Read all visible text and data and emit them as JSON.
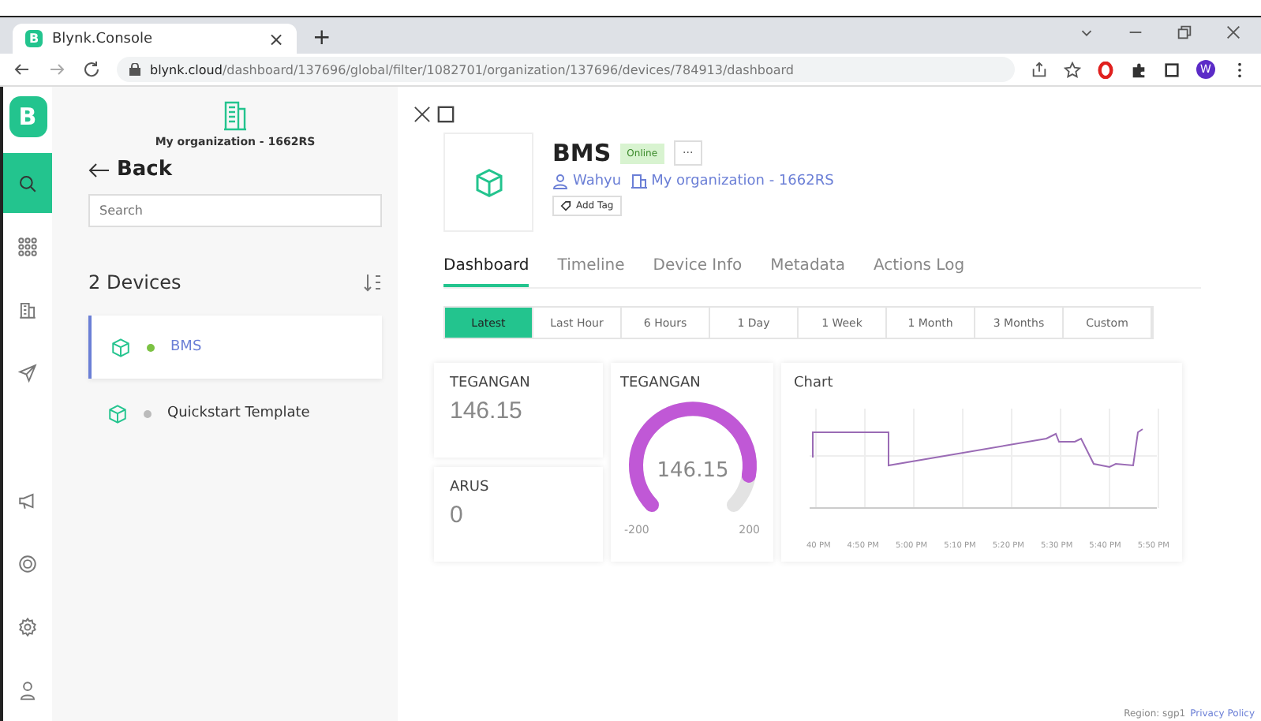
{
  "browser": {
    "favicon": "B",
    "tab_title": "Blynk.Console",
    "tab_close": "×",
    "new_tab": "+",
    "url_host": "blynk.cloud",
    "url_path": "/dashboard/137696/global/filter/1082701/organization/137696/devices/784913/dashboard",
    "profile": "W"
  },
  "rail": {
    "logo": "B",
    "items": [
      {
        "kind": "search",
        "selected": true
      },
      {
        "kind": "grid",
        "selected": false
      },
      {
        "kind": "building",
        "selected": false
      },
      {
        "kind": "send",
        "selected": false
      }
    ],
    "bottom_items": [
      {
        "kind": "megaphone",
        "selected": false
      },
      {
        "kind": "help",
        "selected": false
      },
      {
        "kind": "settings",
        "selected": false
      },
      {
        "kind": "user",
        "selected": false
      }
    ]
  },
  "sidebar": {
    "organization": "My organization - 1662RS",
    "back": "Back",
    "search": {
      "placeholder": "Search"
    },
    "count": "2 Devices",
    "devices": [
      {
        "name": "BMS",
        "online": true,
        "selected": true
      },
      {
        "name": "Quickstart Template",
        "online": false,
        "selected": false
      }
    ]
  },
  "device": {
    "name": "BMS",
    "status": "Online",
    "more": "···",
    "owner": "Wahyu",
    "organization": "My organization - 1662RS",
    "add_tag": "Add Tag"
  },
  "tabs": [
    {
      "label": "Dashboard",
      "selected": true
    },
    {
      "label": "Timeline",
      "selected": false
    },
    {
      "label": "Device Info",
      "selected": false
    },
    {
      "label": "Metadata",
      "selected": false
    },
    {
      "label": "Actions Log",
      "selected": false
    }
  ],
  "ranges": [
    {
      "label": "Latest",
      "selected": true
    },
    {
      "label": "Last Hour",
      "selected": false
    },
    {
      "label": "6 Hours",
      "selected": false
    },
    {
      "label": "1 Day",
      "selected": false
    },
    {
      "label": "1 Week",
      "selected": false
    },
    {
      "label": "1 Month",
      "selected": false
    },
    {
      "label": "3 Months",
      "selected": false
    },
    {
      "label": "Custom",
      "selected": false
    }
  ],
  "widgets": [
    {
      "kind": "value",
      "title": "TEGANGAN",
      "value": "146.15"
    },
    {
      "kind": "value",
      "title": "ARUS",
      "value": "0"
    }
  ],
  "gauge": {
    "title": "TEGANGAN",
    "value": "146.15",
    "min": "-200",
    "max": "200"
  },
  "chart": {
    "title": "Chart",
    "x_labels": [
      "40 PM",
      "4:50 PM",
      "5:00 PM",
      "5:10 PM",
      "5:20 PM",
      "5:30 PM",
      "5:40 PM",
      "5:50 PM"
    ]
  },
  "footer": {
    "region": "Region: sgp1",
    "privacy": "Privacy Policy"
  }
}
